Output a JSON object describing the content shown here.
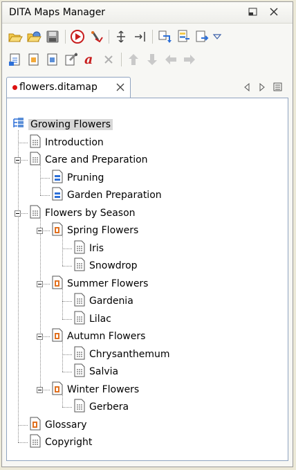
{
  "panel": {
    "title": "DITA Maps Manager"
  },
  "tab": {
    "label": "flowers.ditamap"
  },
  "colors": {
    "accent_blue": "#4a78c8",
    "map_orange": "#e07020",
    "close_red": "#c81e1e",
    "modified_dot": "#dd1111"
  },
  "toolbar": {
    "row1": [
      "open-map-icon",
      "open-url-icon",
      "save-icon",
      "validate-icon",
      "check-spelling-icon",
      "expand-all-icon",
      "collapse-all-icon",
      "refresh-references-icon",
      "transform-icon",
      "export-icon",
      "view-menu-icon"
    ],
    "row2": [
      "new-topic-icon",
      "insert-reference-icon",
      "insert-map-icon",
      "edit-properties-icon",
      "rename-icon",
      "delete-icon",
      "move-up-icon",
      "move-down-icon",
      "promote-icon",
      "demote-icon"
    ]
  },
  "tree": {
    "root": "Growing Flowers",
    "items": [
      {
        "label": "Introduction"
      },
      {
        "label": "Care and Preparation"
      },
      {
        "label": "Pruning"
      },
      {
        "label": "Garden Preparation"
      },
      {
        "label": "Flowers by Season"
      },
      {
        "label": "Spring Flowers"
      },
      {
        "label": "Iris"
      },
      {
        "label": "Snowdrop"
      },
      {
        "label": "Summer Flowers"
      },
      {
        "label": "Gardenia"
      },
      {
        "label": "Lilac"
      },
      {
        "label": "Autumn Flowers"
      },
      {
        "label": "Chrysanthemum"
      },
      {
        "label": "Salvia"
      },
      {
        "label": "Winter Flowers"
      },
      {
        "label": "Gerbera"
      },
      {
        "label": "Glossary"
      },
      {
        "label": "Copyright"
      }
    ]
  }
}
